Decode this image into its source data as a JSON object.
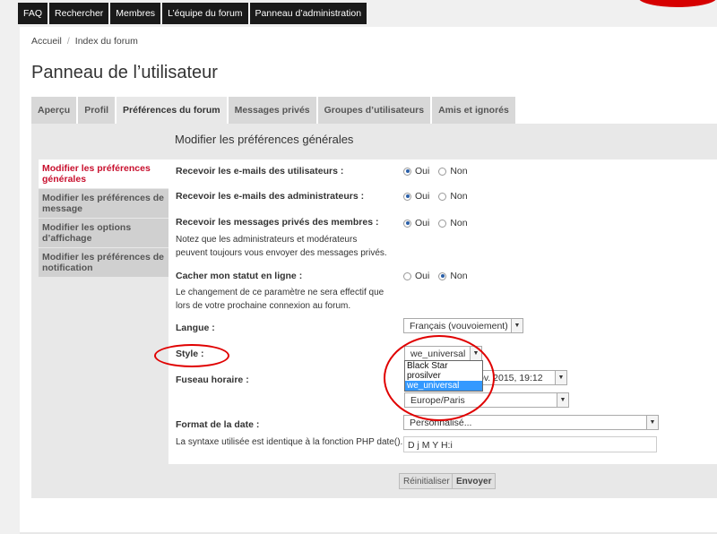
{
  "topnav": [
    "FAQ",
    "Rechercher",
    "Membres",
    "L’équipe du forum",
    "Panneau d’administration"
  ],
  "breadcrumb": {
    "home": "Accueil",
    "sep": "/",
    "index": "Index du forum"
  },
  "page_title": "Panneau de l’utilisateur",
  "tabs": [
    "Aperçu",
    "Profil",
    "Préférences du forum",
    "Messages privés",
    "Groupes d’utilisateurs",
    "Amis et ignorés"
  ],
  "active_tab": "Préférences du forum",
  "sidemenu": [
    "Modifier les préférences générales",
    "Modifier les préférences de message",
    "Modifier les options d’affichage",
    "Modifier les préférences de notification"
  ],
  "section_title": "Modifier les préférences générales",
  "form": {
    "email_users": {
      "label": "Recevoir les e-mails des utilisateurs :",
      "selected": "Oui"
    },
    "email_admins": {
      "label": "Recevoir les e-mails des administrateurs :",
      "selected": "Oui"
    },
    "pm_members": {
      "label": "Recevoir les messages privés des membres :",
      "selected": "Oui",
      "note": "Notez que les administrateurs et modérateurs peuvent toujours vous envoyer des messages privés."
    },
    "hide_status": {
      "label": "Cacher mon statut en ligne :",
      "selected": "Non",
      "note": "Le changement de ce paramètre ne sera effectif que lors de votre prochaine connexion au forum."
    },
    "yes": "Oui",
    "no": "Non",
    "lang": {
      "label": "Langue :",
      "value": "Français (vouvoiement)"
    },
    "style": {
      "label": "Style :",
      "value": "we_universal",
      "options": [
        "Black Star",
        "prosilver",
        "we_universal"
      ]
    },
    "timezone": {
      "label": "Fuseau horaire :",
      "date_value": "ov. 2015, 19:12",
      "zone_value": "Europe/Paris"
    },
    "dateformat": {
      "label": "Format de la date :",
      "value": "Personnalisé...",
      "note": "La syntaxe utilisée est identique à la fonction PHP date().",
      "custom": "D j M Y H:i"
    }
  },
  "buttons": {
    "reset": "Réinitialiser",
    "submit": "Envoyer"
  },
  "colors": {
    "accent": "#c8102e",
    "annotation": "#e00000",
    "nav": "#1a1a1a"
  }
}
